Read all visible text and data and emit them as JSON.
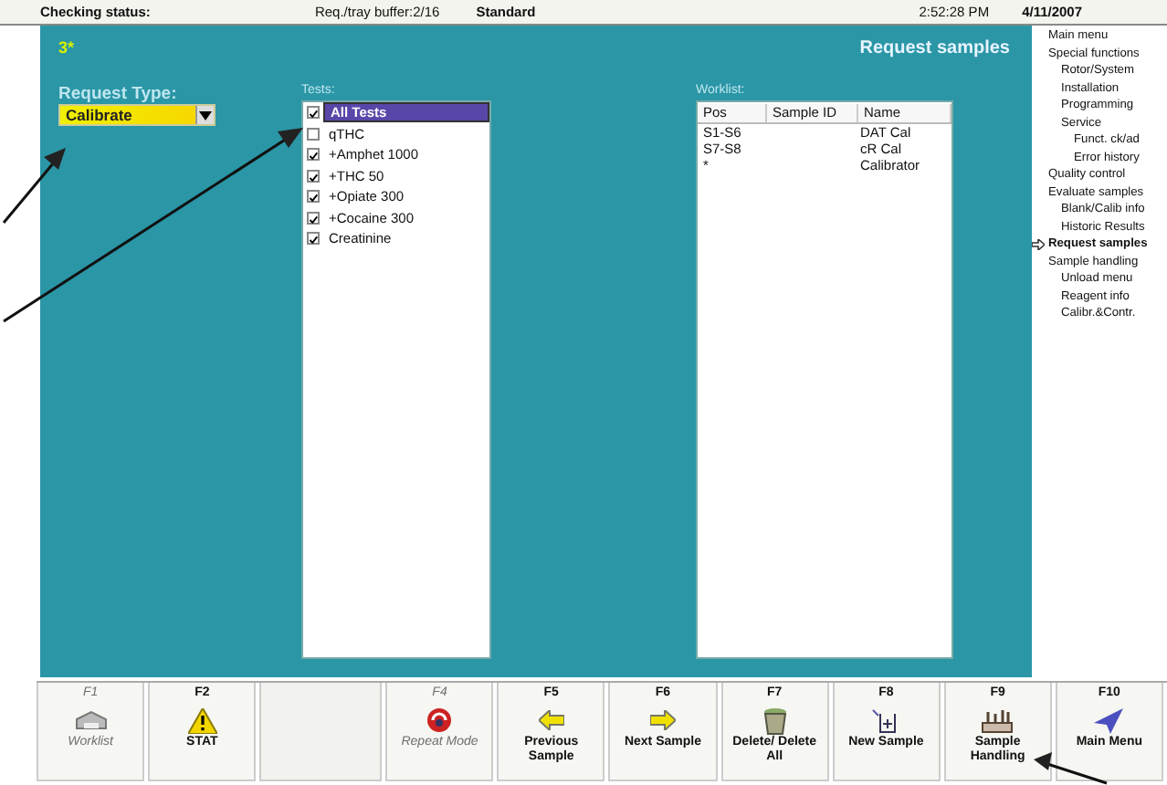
{
  "status_bar": {
    "status": "Checking status:",
    "buffer": "Req./tray buffer:2/16",
    "mode": "Standard",
    "time": "2:52:28 PM",
    "date": "4/11/2007"
  },
  "header": {
    "badge": "3*",
    "title": "Request samples"
  },
  "request_type": {
    "label": "Request Type:",
    "value": "Calibrate"
  },
  "tests": {
    "label": "Tests:",
    "items": [
      {
        "label": "All Tests",
        "checked": true,
        "selected": true
      },
      {
        "label": "qTHC",
        "checked": false,
        "selected": false
      },
      {
        "label": "+Amphet 1000",
        "checked": true,
        "selected": false
      },
      {
        "label": "+THC 50",
        "checked": true,
        "selected": false
      },
      {
        "label": "+Opiate 300",
        "checked": true,
        "selected": false
      },
      {
        "label": "+Cocaine 300",
        "checked": true,
        "selected": false
      },
      {
        "label": "Creatinine",
        "checked": true,
        "selected": false
      }
    ]
  },
  "worklist": {
    "label": "Worklist:",
    "columns": [
      "Pos",
      "Sample ID",
      "Name"
    ],
    "rows": [
      [
        "S1-S6",
        "",
        "DAT Cal"
      ],
      [
        "S7-S8",
        "",
        "cR Cal"
      ],
      [
        "*",
        "",
        "Calibrator"
      ]
    ]
  },
  "menu": [
    {
      "label": "Main menu",
      "selected": false
    },
    {
      "label": "Special functions",
      "selected": false,
      "children": [
        {
          "label": "Rotor/System",
          "selected": false
        },
        {
          "label": "Installation",
          "selected": false
        },
        {
          "label": "Programming",
          "selected": false
        },
        {
          "label": "Service",
          "selected": false,
          "children": [
            {
              "label": "Funct. ck/ad",
              "selected": false
            },
            {
              "label": "Error history",
              "selected": false
            }
          ]
        }
      ]
    },
    {
      "label": "Quality control",
      "selected": false
    },
    {
      "label": "Evaluate samples",
      "selected": false,
      "children": [
        {
          "label": "Blank/Calib info",
          "selected": false
        },
        {
          "label": "Historic Results",
          "selected": false
        }
      ]
    },
    {
      "label": "Request samples",
      "selected": true
    },
    {
      "label": "Sample handling",
      "selected": false,
      "children": [
        {
          "label": "Unload menu",
          "selected": false
        },
        {
          "label": "Reagent info",
          "selected": false
        },
        {
          "label": "Calibr.&Contr.",
          "selected": false
        }
      ]
    }
  ],
  "function_keys": [
    {
      "key": "F1",
      "label": "Worklist",
      "kind": "printer",
      "disabled": true
    },
    {
      "key": "F2",
      "label": "STAT",
      "kind": "warning",
      "disabled": false
    },
    {
      "kind": "blank"
    },
    {
      "key": "F4",
      "label": "Repeat Mode",
      "kind": "repeat",
      "disabled": true
    },
    {
      "key": "F5",
      "label": "Previous Sample",
      "kind": "left",
      "disabled": false
    },
    {
      "key": "F6",
      "label": "Next Sample",
      "kind": "right",
      "disabled": false
    },
    {
      "key": "F7",
      "label": "Delete/ Delete All",
      "kind": "trash",
      "disabled": false
    },
    {
      "key": "F8",
      "label": "New Sample",
      "kind": "new",
      "disabled": false
    },
    {
      "key": "F9",
      "label": "Sample Handling",
      "kind": "rack",
      "disabled": false
    },
    {
      "key": "F10",
      "label": "Main Menu",
      "kind": "navigate",
      "disabled": false
    }
  ]
}
